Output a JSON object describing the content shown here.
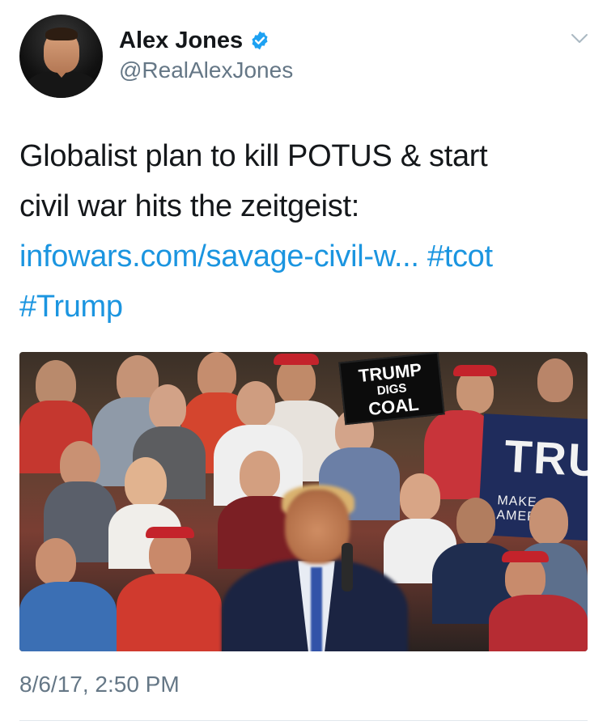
{
  "author": {
    "display_name": "Alex Jones",
    "handle": "@RealAlexJones",
    "verified": true
  },
  "tweet": {
    "text_line1": "Globalist plan to kill POTUS & start",
    "text_line2": "civil war hits the zeitgeist:",
    "link": "infowars.com/savage-civil-w...",
    "hashtag1": "#tcot",
    "hashtag2": "#Trump",
    "timestamp": "8/6/17, 2:50 PM"
  },
  "media": {
    "sign_line1": "TRUMP",
    "sign_line2": "DIGS",
    "sign_line3": "COAL",
    "banner_line1": "TRU",
    "banner_line2": "MAKE AMERICA"
  },
  "colors": {
    "link": "#1b95e0",
    "verified": "#1da1f2",
    "secondary_text": "#657786"
  },
  "icons": {
    "verified": "verified-badge-icon",
    "menu": "chevron-down-icon"
  }
}
